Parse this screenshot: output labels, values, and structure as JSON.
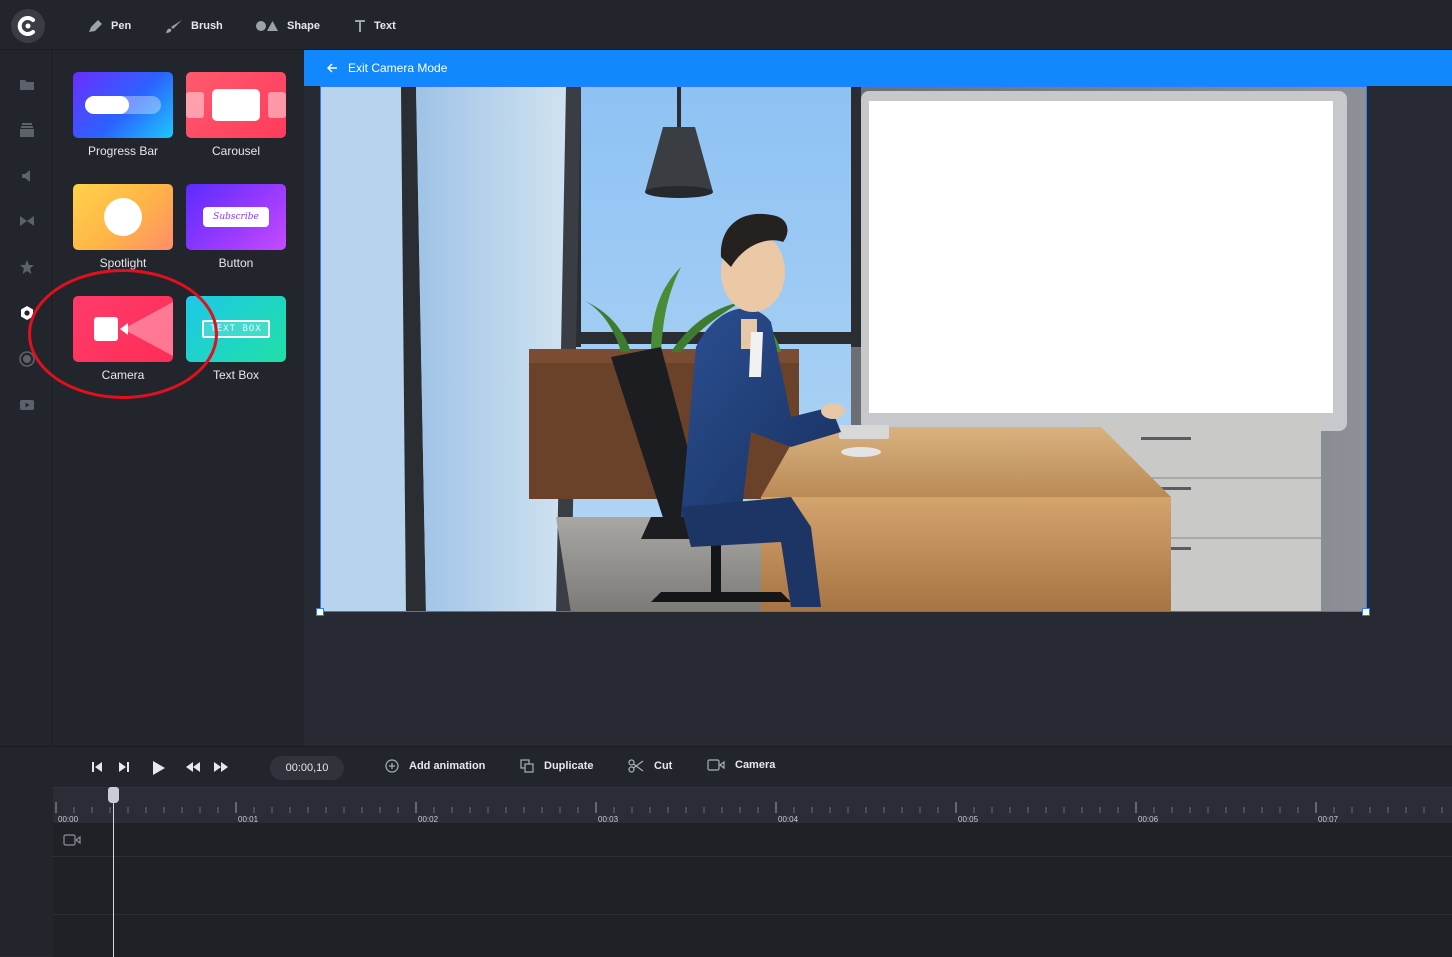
{
  "toolbar": {
    "tools": [
      {
        "label": "Pen",
        "icon": "pen-icon"
      },
      {
        "label": "Brush",
        "icon": "brush-icon"
      },
      {
        "label": "Shape",
        "icon": "shape-icon"
      },
      {
        "label": "Text",
        "icon": "text-icon"
      }
    ]
  },
  "rail": {
    "icons": [
      "folder-icon",
      "layers-icon",
      "speaker-icon",
      "transition-icon",
      "star-icon",
      "widget-icon",
      "record-icon",
      "video-icon"
    ],
    "active": "widget-icon"
  },
  "panel": {
    "tiles": [
      {
        "label": "Progress Bar",
        "thumb_text": ""
      },
      {
        "label": "Carousel",
        "thumb_text": ""
      },
      {
        "label": "Spotlight",
        "thumb_text": ""
      },
      {
        "label": "Button",
        "thumb_text": "Subscribe"
      },
      {
        "label": "Camera",
        "thumb_text": ""
      },
      {
        "label": "Text Box",
        "thumb_text": "TEXT BOX"
      }
    ],
    "highlighted": "Camera"
  },
  "stage": {
    "exit_label": "Exit Camera Mode"
  },
  "timeline": {
    "current_time": "00:00,10",
    "actions": [
      {
        "label": "Add animation",
        "icon": "add-circle-icon"
      },
      {
        "label": "Duplicate",
        "icon": "duplicate-icon"
      },
      {
        "label": "Cut",
        "icon": "scissors-icon"
      },
      {
        "label": "Camera",
        "icon": "camera-icon"
      }
    ],
    "ruler_labels": [
      "00:00",
      "00:01",
      "00:02",
      "00:03",
      "00:04",
      "00:05",
      "00:06",
      "00:07"
    ],
    "track_icon": "camera-icon"
  },
  "colors": {
    "accent": "#1288ff",
    "annotation": "#e0101e",
    "background": "#262932",
    "panel": "#23252c"
  }
}
